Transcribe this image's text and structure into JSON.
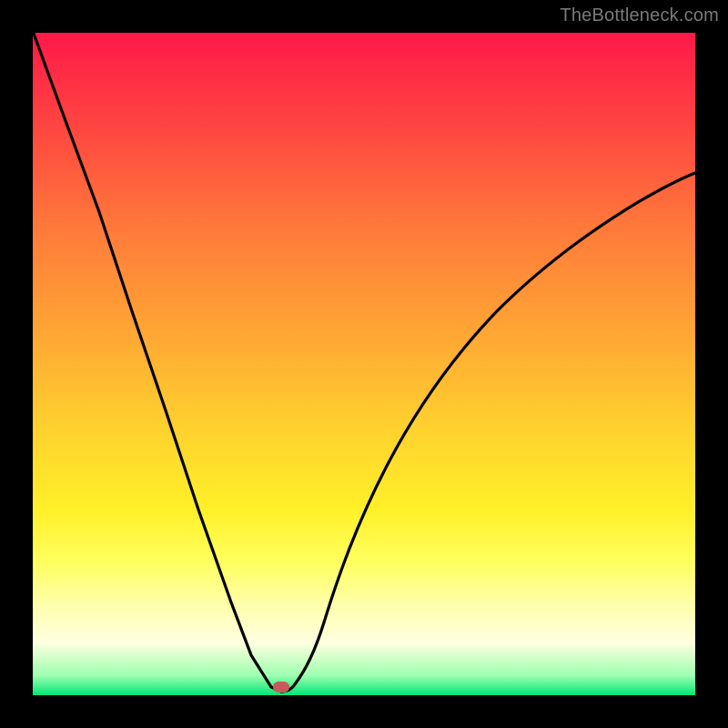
{
  "watermark": "TheBottleneck.com",
  "colors": {
    "frame": "#000000",
    "curve": "#000000",
    "marker": "#c85a5a",
    "gradient_stops": [
      "#ff1948",
      "#ff4840",
      "#ff7b3a",
      "#ffa534",
      "#ffd22e",
      "#fff028",
      "#ffff60",
      "#ffffa8",
      "#ffffe0",
      "#9effb0",
      "#00e676"
    ]
  },
  "chart_data": {
    "type": "line",
    "title": "",
    "xlabel": "",
    "ylabel": "",
    "xlim": [
      0,
      100
    ],
    "ylim": [
      0,
      100
    ],
    "legend": false,
    "grid": false,
    "series": [
      {
        "name": "bottleneck-curve-left",
        "x": [
          0,
          4.5,
          10,
          15,
          20,
          25,
          30,
          33,
          36,
          37.5
        ],
        "y": [
          100,
          88,
          73,
          58,
          43,
          28,
          14,
          6,
          1.2,
          0.5
        ]
      },
      {
        "name": "bottleneck-curve-right",
        "x": [
          37.5,
          39,
          42,
          46,
          52,
          60,
          70,
          80,
          90,
          100
        ],
        "y": [
          0.5,
          1.5,
          6,
          14,
          26,
          41,
          56,
          66,
          73,
          78
        ]
      }
    ],
    "marker": {
      "x": 37.5,
      "y": 0.5,
      "shape": "rounded-rect"
    },
    "annotations": [
      {
        "text": "TheBottleneck.com",
        "position": "top-right"
      }
    ]
  }
}
